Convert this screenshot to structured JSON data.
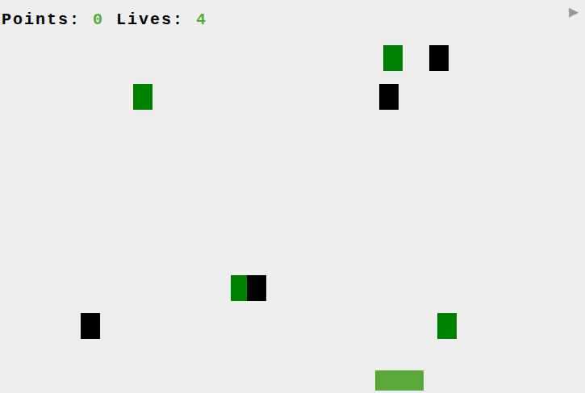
{
  "hud": {
    "points_label": "Points:",
    "points": "0",
    "lives_label": "Lives:",
    "lives": "4"
  },
  "play_button": "▶",
  "blocks": [
    {
      "color": "#008000"
    },
    {
      "color": "#000000"
    },
    {
      "color": "#008000"
    },
    {
      "color": "#000000"
    },
    {
      "color": "#008000"
    },
    {
      "color": "#000000"
    },
    {
      "color": "#000000"
    },
    {
      "color": "#008000"
    }
  ]
}
